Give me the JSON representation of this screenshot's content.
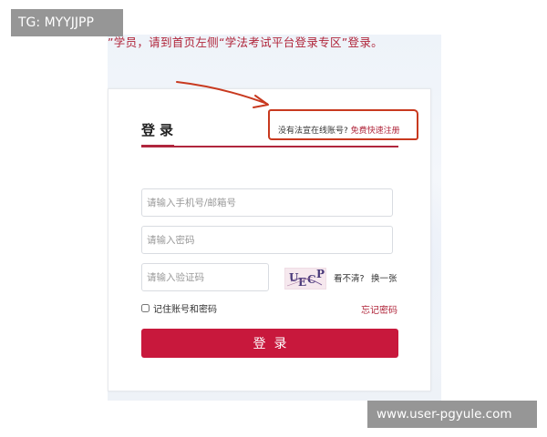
{
  "notice": {
    "text": "”学员，请到首页左侧“学法考试平台登录专区”登录。"
  },
  "login": {
    "title": "登录",
    "register_prompt": "没有法宣在线账号?",
    "register_link": "免费快速注册",
    "username_placeholder": "请输入手机号/邮箱号",
    "password_placeholder": "请输入密码",
    "captcha_placeholder": "请输入验证码",
    "captcha_letters": [
      "U",
      "E",
      "C",
      "P"
    ],
    "cant_see": "看不清?",
    "refresh_captcha": "换一张",
    "remember_label": "记住账号和密码",
    "forgot_password": "忘记密码",
    "submit_label": "登录"
  },
  "overlays": {
    "top_left": "TG: MYYJJPP",
    "bottom_right": "www.user-pgyule.com"
  },
  "colors": {
    "brand_red": "#c8183c",
    "link_red": "#b0253a",
    "annotation_red": "#c8391f"
  },
  "icons": [
    "checkbox-icon",
    "annotation-arrow-icon",
    "captcha-image"
  ]
}
